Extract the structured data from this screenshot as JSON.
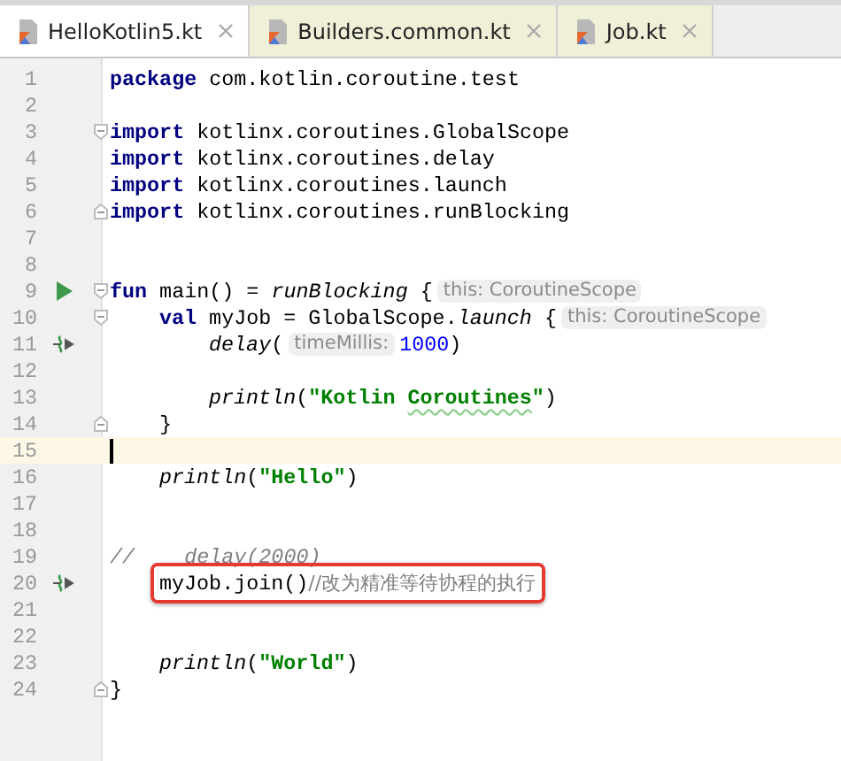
{
  "tabs": [
    {
      "label": "HelloKotlin5.kt",
      "selected": true
    },
    {
      "label": "Builders.common.kt",
      "selected": false
    },
    {
      "label": "Job.kt",
      "selected": false
    }
  ],
  "editor": {
    "lines": [
      {
        "number": "1",
        "tokens": [
          {
            "kind": "keyword",
            "text": "package"
          },
          {
            "kind": "plain",
            "text": " com.kotlin.coroutine.test"
          }
        ]
      },
      {
        "number": "2"
      },
      {
        "number": "3",
        "fold_start": true,
        "tokens": [
          {
            "kind": "keyword",
            "text": "import"
          },
          {
            "kind": "plain",
            "text": " kotlinx.coroutines.GlobalScope"
          }
        ]
      },
      {
        "number": "4",
        "tokens": [
          {
            "kind": "keyword",
            "text": "import"
          },
          {
            "kind": "plain",
            "text": " kotlinx.coroutines.delay"
          }
        ]
      },
      {
        "number": "5",
        "tokens": [
          {
            "kind": "keyword",
            "text": "import"
          },
          {
            "kind": "plain",
            "text": " kotlinx.coroutines.launch"
          }
        ]
      },
      {
        "number": "6",
        "fold_end": true,
        "tokens": [
          {
            "kind": "keyword",
            "text": "import"
          },
          {
            "kind": "plain",
            "text": " kotlinx.coroutines.runBlocking"
          }
        ]
      },
      {
        "number": "7"
      },
      {
        "number": "8"
      },
      {
        "number": "9",
        "run_marker": true,
        "fold_start": true,
        "tokens": [
          {
            "kind": "keyword",
            "text": "fun"
          },
          {
            "kind": "plain",
            "text": " main() = "
          },
          {
            "kind": "call",
            "text": "runBlocking"
          },
          {
            "kind": "plain",
            "text": " {"
          },
          {
            "kind": "hint",
            "text": "this: CoroutineScope"
          }
        ]
      },
      {
        "number": "10",
        "fold_start": true,
        "indented": true,
        "tokens": [
          {
            "kind": "keyword",
            "text": "val"
          },
          {
            "kind": "plain",
            "text": " myJob = GlobalScope."
          },
          {
            "kind": "call",
            "text": "launch"
          },
          {
            "kind": "plain",
            "text": " {"
          },
          {
            "kind": "hint",
            "text": "this: CoroutineScope"
          }
        ]
      },
      {
        "number": "11",
        "suspend_marker": true,
        "indented": true,
        "double_indented": true,
        "tokens": [
          {
            "kind": "call",
            "text": "delay"
          },
          {
            "kind": "plain",
            "text": "("
          },
          {
            "kind": "hint",
            "text": "timeMillis:"
          },
          {
            "kind": "number",
            "text": "1000"
          },
          {
            "kind": "plain",
            "text": ")"
          }
        ]
      },
      {
        "number": "12"
      },
      {
        "number": "13",
        "indented": true,
        "double_indented": true,
        "tokens": [
          {
            "kind": "call",
            "text": "println"
          },
          {
            "kind": "plain",
            "text": "("
          },
          {
            "kind": "string",
            "text": "\"Kotlin "
          },
          {
            "kind": "typo",
            "text": "Coroutines"
          },
          {
            "kind": "string",
            "text": "\""
          },
          {
            "kind": "plain",
            "text": ")"
          }
        ]
      },
      {
        "number": "14",
        "fold_end": true,
        "indented": true,
        "tokens": [
          {
            "kind": "plain",
            "text": "}"
          }
        ]
      },
      {
        "number": "15",
        "current": true
      },
      {
        "number": "16",
        "indented": true,
        "tokens": [
          {
            "kind": "call",
            "text": "println"
          },
          {
            "kind": "plain",
            "text": "("
          },
          {
            "kind": "string",
            "text": "\"Hello\""
          },
          {
            "kind": "plain",
            "text": ")"
          }
        ]
      },
      {
        "number": "17"
      },
      {
        "number": "18"
      },
      {
        "number": "19",
        "tokens": [
          {
            "kind": "comment",
            "text": "//    delay(2000)"
          }
        ]
      },
      {
        "number": "20",
        "suspend_marker": true,
        "boxed": true,
        "indented": true,
        "tokens": [
          {
            "kind": "plain",
            "text": "myJob.join()"
          },
          {
            "kind": "line_comment",
            "text": "//改为精准等待协程的执行"
          }
        ]
      },
      {
        "number": "21"
      },
      {
        "number": "22"
      },
      {
        "number": "23",
        "indented": true,
        "tokens": [
          {
            "kind": "call",
            "text": "println"
          },
          {
            "kind": "plain",
            "text": "("
          },
          {
            "kind": "string",
            "text": "\"World\""
          },
          {
            "kind": "plain",
            "text": ")"
          }
        ]
      },
      {
        "number": "24",
        "fold_end": true,
        "tokens": [
          {
            "kind": "plain",
            "text": "}"
          }
        ]
      }
    ]
  }
}
